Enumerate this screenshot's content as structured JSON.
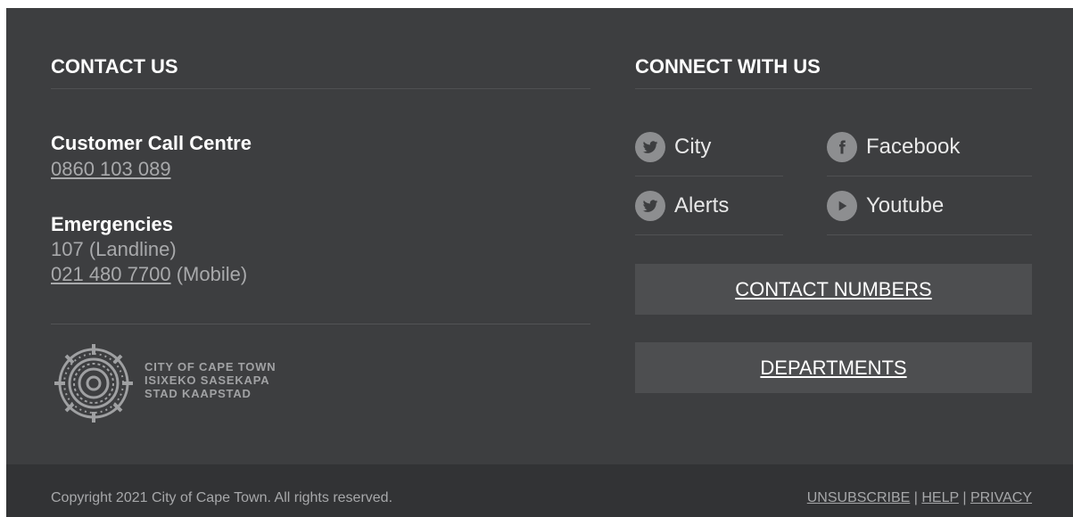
{
  "contact": {
    "heading": "CONTACT US",
    "call_centre_label": "Customer Call Centre",
    "call_centre_number": "0860 103 089",
    "emergencies_label": "Emergencies",
    "landline": "107 (Landline)",
    "mobile_number": "021 480 7700",
    "mobile_suffix": " (Mobile)"
  },
  "logo": {
    "lines": [
      "CITY OF CAPE TOWN",
      "ISIXEKO SASEKAPA",
      "STAD KAAPSTAD"
    ]
  },
  "connect": {
    "heading": "CONNECT WITH US",
    "social": [
      {
        "label": "City",
        "icon": "twitter-icon"
      },
      {
        "label": "Facebook",
        "icon": "facebook-icon"
      },
      {
        "label": "Alerts",
        "icon": "twitter-icon"
      },
      {
        "label": "Youtube",
        "icon": "youtube-icon"
      }
    ],
    "contact_numbers_button": "CONTACT NUMBERS",
    "departments_button": "DEPARTMENTS"
  },
  "bottom": {
    "copyright": "Copyright 2021 City of Cape Town. All rights reserved.",
    "links": [
      "UNSUBSCRIBE",
      "HELP",
      "PRIVACY"
    ],
    "separator": " | "
  },
  "colors": {
    "background": "#3d3e40",
    "bottom_bar": "#323335",
    "button": "#4d4e50",
    "icon_circle": "#8d8e90"
  }
}
